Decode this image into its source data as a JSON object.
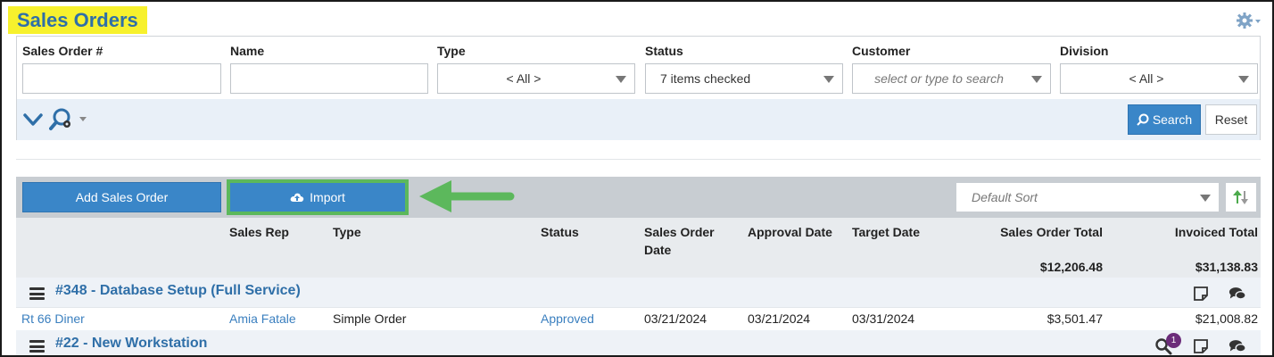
{
  "page": {
    "title": "Sales Orders"
  },
  "filters": {
    "sales_order": {
      "label": "Sales Order #",
      "value": ""
    },
    "name": {
      "label": "Name",
      "value": ""
    },
    "type": {
      "label": "Type",
      "value": "< All >"
    },
    "status": {
      "label": "Status",
      "value": "7 items checked"
    },
    "customer": {
      "label": "Customer",
      "placeholder": "select or type to search"
    },
    "division": {
      "label": "Division",
      "value": "< All >"
    },
    "search_label": "Search",
    "reset_label": "Reset"
  },
  "toolbar": {
    "add_label": "Add Sales Order",
    "import_label": "Import",
    "sort_placeholder": "Default Sort",
    "highlight_color": "#5cb85c"
  },
  "table": {
    "columns": {
      "sales_rep": "Sales Rep",
      "type": "Type",
      "status": "Status",
      "order_date_line1": "Sales Order",
      "order_date_line2": "Date",
      "approval_date": "Approval Date",
      "target_date": "Target Date",
      "order_total": "Sales Order Total",
      "invoiced_total": "Invoiced Total"
    },
    "totals": {
      "order_total": "$12,206.48",
      "invoiced_total": "$31,138.83"
    },
    "groups": [
      {
        "title": "#348 - Database Setup (Full Service)",
        "row": {
          "customer": "Rt 66 Diner",
          "sales_rep": "Amia Fatale",
          "type": "Simple Order",
          "status": "Approved",
          "order_date": "03/21/2024",
          "approval_date": "03/21/2024",
          "target_date": "03/31/2024",
          "order_total": "$3,501.47",
          "invoiced_total": "$21,008.82"
        }
      },
      {
        "title": "#22 - New Workstation",
        "badge_count": "1"
      }
    ]
  },
  "colors": {
    "brand_blue": "#3a86c8",
    "title_highlight": "#f7f12d",
    "badge": "#6b2c7a"
  }
}
